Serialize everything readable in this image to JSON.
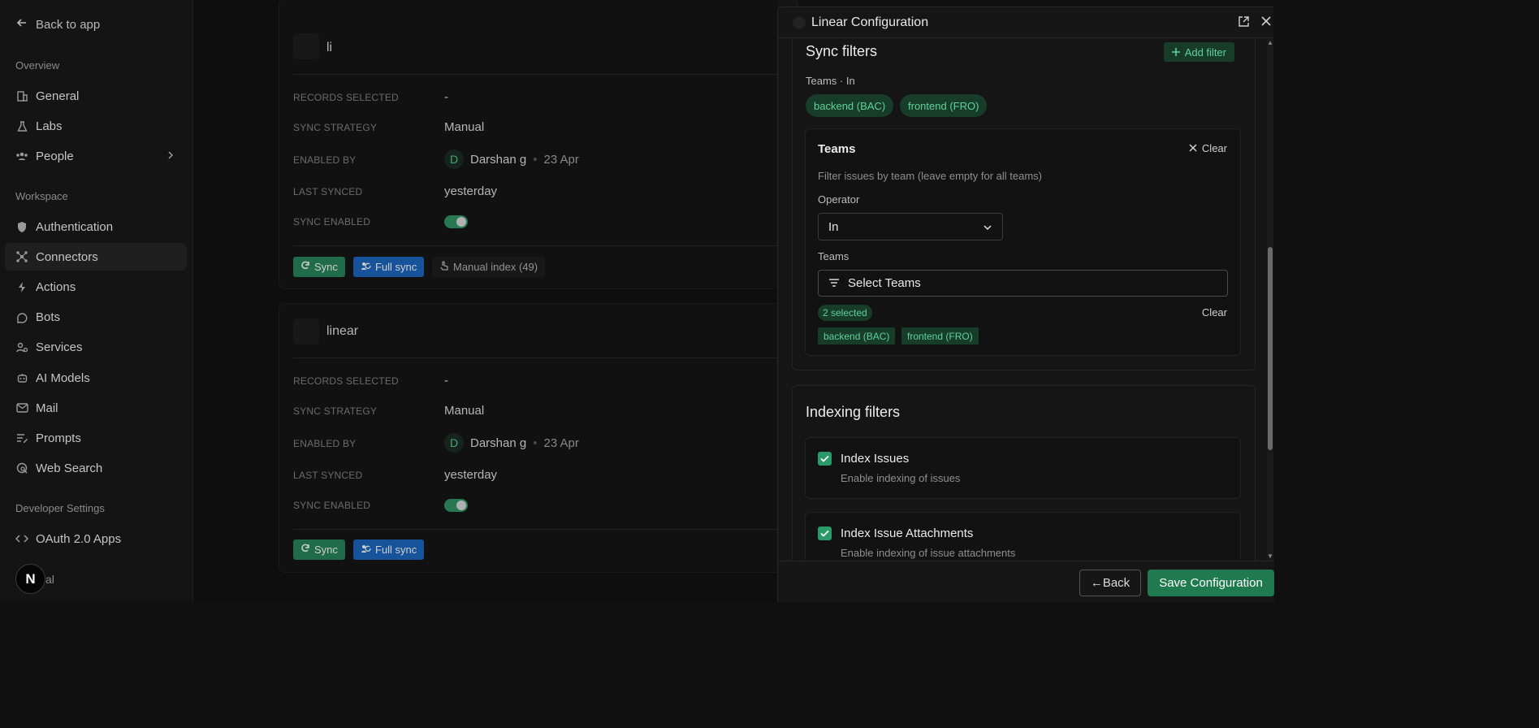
{
  "sidebar": {
    "back_label": "Back to app",
    "overview_heading": "Overview",
    "overview_items": [
      {
        "label": "General",
        "icon": "building-icon"
      },
      {
        "label": "Labs",
        "icon": "flask-icon"
      },
      {
        "label": "People",
        "icon": "people-icon"
      }
    ],
    "workspace_heading": "Workspace",
    "workspace_items": [
      {
        "label": "Authentication",
        "icon": "shield-icon"
      },
      {
        "label": "Connectors",
        "icon": "network-icon"
      },
      {
        "label": "Actions",
        "icon": "bolt-icon"
      },
      {
        "label": "Bots",
        "icon": "bot-icon"
      },
      {
        "label": "Services",
        "icon": "services-icon"
      },
      {
        "label": "AI Models",
        "icon": "robot-icon"
      },
      {
        "label": "Mail",
        "icon": "mail-icon"
      },
      {
        "label": "Prompts",
        "icon": "prompts-icon"
      },
      {
        "label": "Web Search",
        "icon": "web-search-icon"
      }
    ],
    "dev_heading": "Developer Settings",
    "dev_items": [
      {
        "label": "OAuth 2.0 Apps",
        "icon": "code-icon"
      }
    ],
    "avatar_letter": "N",
    "footer_text": "al"
  },
  "cards": [
    {
      "name": "li",
      "records_label": "RECORDS SELECTED",
      "records_value": "-",
      "strategy_label": "SYNC STRATEGY",
      "strategy_value": "Manual",
      "enabled_by_label": "ENABLED BY",
      "enabled_initial": "D",
      "enabled_by": "Darshan g",
      "enabled_date": "23 Apr",
      "last_synced_label": "LAST SYNCED",
      "last_synced": "yesterday",
      "sync_enabled_label": "SYNC ENABLED",
      "btn_sync": "Sync",
      "btn_full_sync": "Full sync",
      "btn_manual_index": "Manual index (49)"
    },
    {
      "name": "linear",
      "records_label": "RECORDS SELECTED",
      "records_value": "-",
      "strategy_label": "SYNC STRATEGY",
      "strategy_value": "Manual",
      "enabled_by_label": "ENABLED BY",
      "enabled_initial": "D",
      "enabled_by": "Darshan g",
      "enabled_date": "23 Apr",
      "last_synced_label": "LAST SYNCED",
      "last_synced": "yesterday",
      "sync_enabled_label": "SYNC ENABLED",
      "btn_sync": "Sync",
      "btn_full_sync": "Full sync"
    }
  ],
  "panel": {
    "title": "Linear Configuration",
    "sync_filters": {
      "heading": "Sync filters",
      "add_filter": "Add filter",
      "summary_label": "Teams · In",
      "summary_pills": [
        "backend (BAC)",
        "frontend (FRO)"
      ],
      "teams_card": {
        "title": "Teams",
        "clear": "Clear",
        "description": "Filter issues by team (leave empty for all teams)",
        "operator_label": "Operator",
        "operator_value": "In",
        "teams_label": "Teams",
        "teams_placeholder": "Select Teams",
        "selected_count": "2 selected",
        "clear_selected": "Clear",
        "tags": [
          "backend (BAC)",
          "frontend (FRO)"
        ]
      }
    },
    "indexing_filters": {
      "heading": "Indexing filters",
      "items": [
        {
          "title": "Index Issues",
          "description": "Enable indexing of issues",
          "checked": true
        },
        {
          "title": "Index Issue Attachments",
          "description": "Enable indexing of issue attachments",
          "checked": true
        }
      ]
    },
    "footer": {
      "back": "←Back",
      "save": "Save Configuration"
    }
  },
  "colors": {
    "accent_green": "#1f7a4f",
    "accent_blue": "#1a5fb0",
    "pill_text": "#5fd39a"
  }
}
